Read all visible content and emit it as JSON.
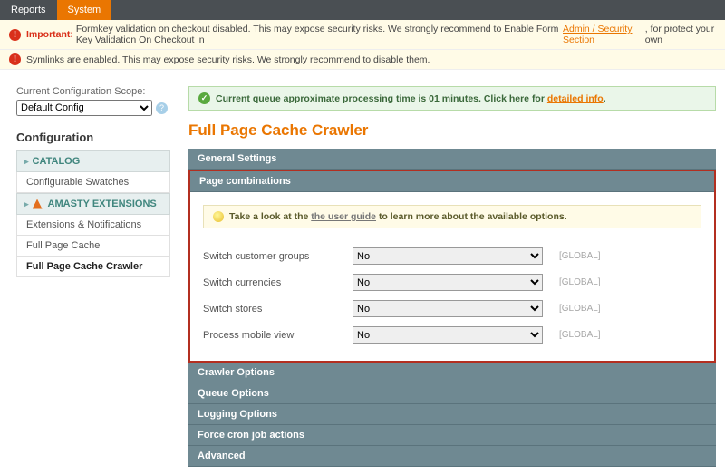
{
  "topbar": {
    "tabs": [
      "Reports",
      "System"
    ],
    "active": "System"
  },
  "notices": {
    "n1_label": "Important:",
    "n1_text": "Formkey validation on checkout disabled. This may expose security risks. We strongly recommend to Enable Form Key Validation On Checkout in ",
    "n1_link": "Admin / Security Section",
    "n1_tail": ", for protect your own",
    "n2_text": "Symlinks are enabled. This may expose security risks. We strongly recommend to disable them."
  },
  "scope": {
    "label": "Current Configuration Scope:",
    "value": "Default Config"
  },
  "sidebar": {
    "title": "Configuration",
    "catalog_heading": "CATALOG",
    "catalog_items": [
      "Configurable Swatches"
    ],
    "amasty_heading": "AMASTY EXTENSIONS",
    "amasty_items": [
      "Extensions & Notifications",
      "Full Page Cache",
      "Full Page Cache Crawler"
    ],
    "active": "Full Page Cache Crawler"
  },
  "queue": {
    "text": "Current queue approximate processing time is 01 minutes. Click here for ",
    "link": "detailed info",
    "tail": "."
  },
  "page_title": "Full Page Cache Crawler",
  "sections": {
    "general": "General Settings",
    "page_comb": "Page combinations",
    "crawler": "Crawler Options",
    "queue_opt": "Queue Options",
    "logging": "Logging Options",
    "force": "Force cron job actions",
    "advanced": "Advanced"
  },
  "tip": {
    "pre": "Take a look at the ",
    "link": "the user guide",
    "post": " to learn more about the available options."
  },
  "rows": [
    {
      "label": "Switch customer groups",
      "value": "No",
      "scope": "[GLOBAL]"
    },
    {
      "label": "Switch currencies",
      "value": "No",
      "scope": "[GLOBAL]"
    },
    {
      "label": "Switch stores",
      "value": "No",
      "scope": "[GLOBAL]"
    },
    {
      "label": "Process mobile view",
      "value": "No",
      "scope": "[GLOBAL]"
    }
  ]
}
